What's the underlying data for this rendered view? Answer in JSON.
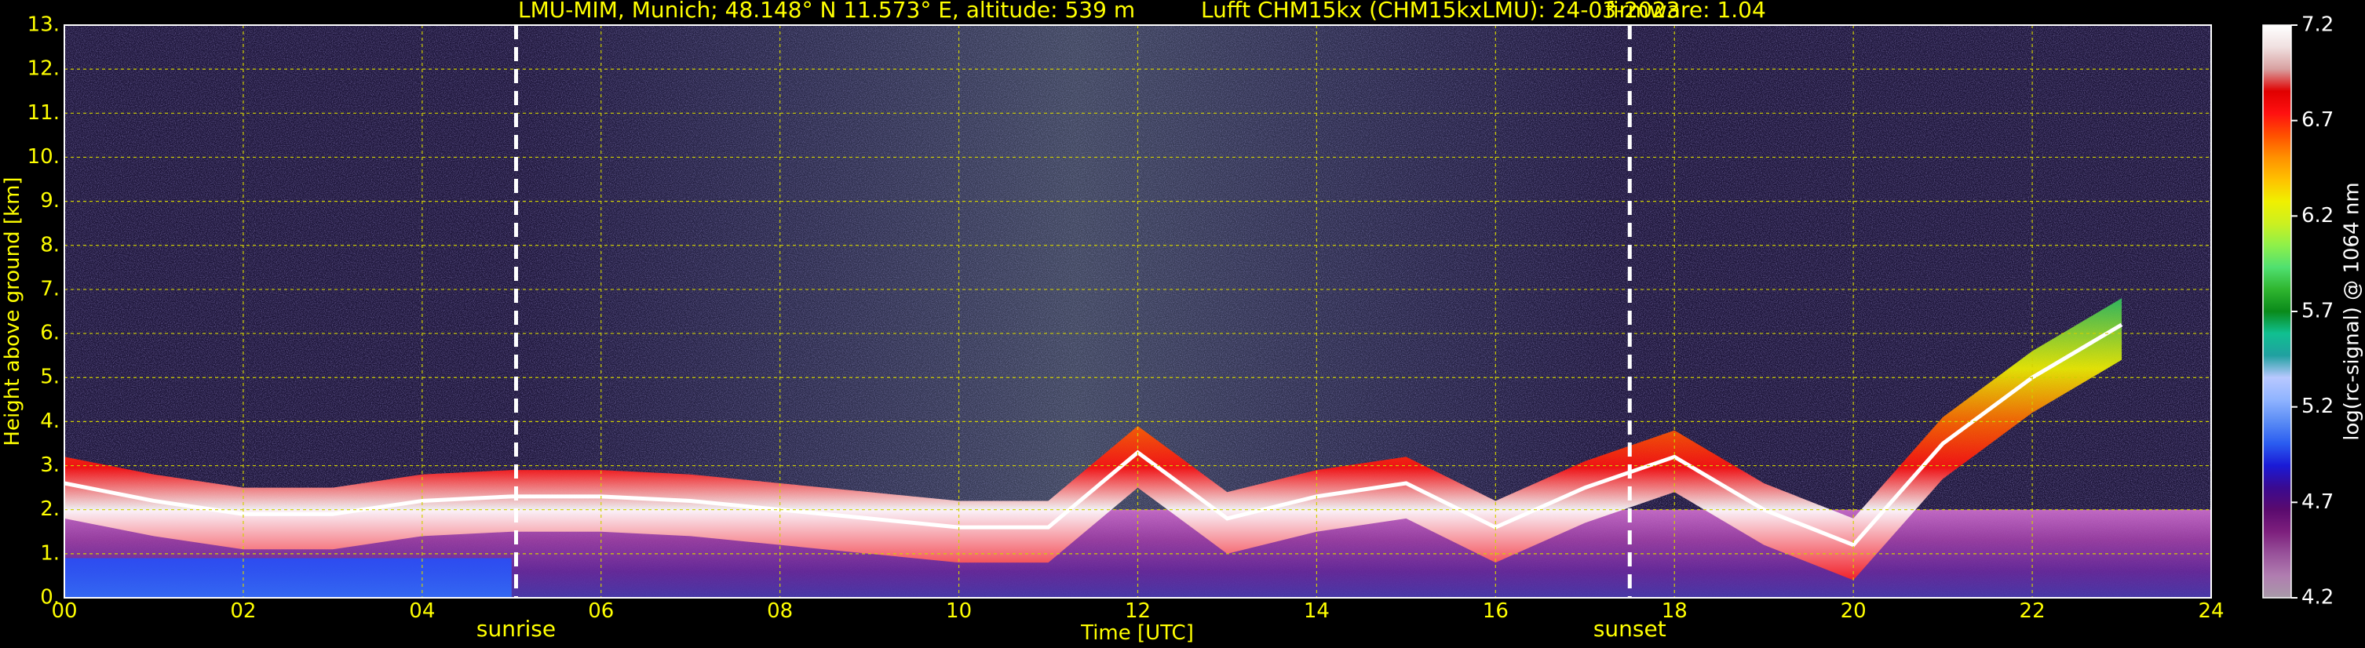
{
  "title": {
    "location": "LMU-MIM, Munich; 48.148° N 11.573° E, altitude: 539 m",
    "instrument": "Lufft CHM15kx (CHM15kxLMU): 24-03-2023",
    "firmware": "firmware: 1.04"
  },
  "chart_data": {
    "type": "heatmap",
    "xlabel": "Time [UTC]",
    "ylabel": "Height above ground [km]",
    "xlim": [
      0,
      24
    ],
    "ylim": [
      0,
      13
    ],
    "x_ticks": [
      "00",
      "02",
      "04",
      "06",
      "08",
      "10",
      "12",
      "14",
      "16",
      "18",
      "20",
      "22",
      "24"
    ],
    "y_ticks": [
      "0.",
      "1.",
      "2.",
      "3.",
      "4.",
      "5.",
      "6.",
      "7.",
      "8.",
      "9.",
      "10.",
      "11.",
      "12.",
      "13."
    ],
    "grid": true,
    "annotations": [
      {
        "label": "sunrise",
        "time": 5.05
      },
      {
        "label": "sunset",
        "time": 17.5
      }
    ],
    "colorbar": {
      "label": "log(rc-signal) @ 1064 nm",
      "range": [
        4.2,
        7.2
      ],
      "ticks": [
        "7.2",
        "6.7",
        "6.2",
        "5.7",
        "5.2",
        "4.7",
        "4.2"
      ],
      "colors": [
        "#a89aa8",
        "#b07db0",
        "#98529a",
        "#7d1f7d",
        "#5a0a6e",
        "#3a0a90",
        "#1a1ad6",
        "#2a5cf0",
        "#5a8cf5",
        "#90b4ff",
        "#b8c8ff",
        "#20a0a0",
        "#10c090",
        "#0a8a1a",
        "#2fb52f",
        "#50e070",
        "#8ef04a",
        "#ccf020",
        "#f0f000",
        "#ffc000",
        "#ff9000",
        "#ff5000",
        "#ff1010",
        "#e00000",
        "#d8a0a0",
        "#f0e0e0",
        "#ffffff"
      ]
    },
    "cloud_base_km": [
      [
        0.0,
        2.6
      ],
      [
        1.0,
        2.2
      ],
      [
        2.0,
        1.9
      ],
      [
        3.0,
        1.9
      ],
      [
        4.0,
        2.2
      ],
      [
        5.0,
        2.3
      ],
      [
        6.0,
        2.3
      ],
      [
        7.0,
        2.2
      ],
      [
        8.0,
        2.0
      ],
      [
        9.0,
        1.8
      ],
      [
        10.0,
        1.6
      ],
      [
        11.0,
        1.6
      ],
      [
        12.0,
        3.3
      ],
      [
        13.0,
        1.8
      ],
      [
        14.0,
        2.3
      ],
      [
        15.0,
        2.6
      ],
      [
        16.0,
        1.6
      ],
      [
        17.0,
        2.5
      ],
      [
        18.0,
        3.2
      ],
      [
        19.0,
        2.0
      ],
      [
        20.0,
        1.2
      ],
      [
        21.0,
        3.5
      ],
      [
        22.0,
        5.0
      ],
      [
        23.0,
        6.2
      ]
    ],
    "boundary_layer_km": 2.0
  }
}
